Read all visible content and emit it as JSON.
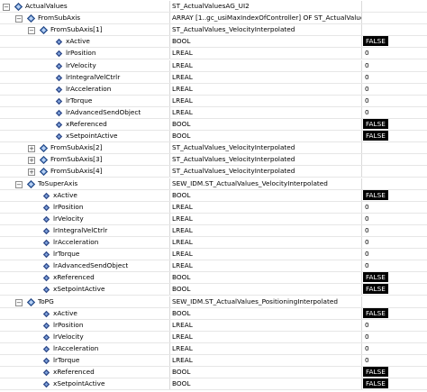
{
  "colors": {
    "false_badge_bg": "#000000",
    "false_badge_fg": "#ffffff",
    "icon_blue": "#2f4a8a"
  },
  "rows": [
    {
      "level": 0,
      "exp": "minus",
      "icon": "struct-icon",
      "name": "ActualValues",
      "type": "ST_ActualValuesAG_UI2",
      "value": ""
    },
    {
      "level": 1,
      "exp": "minus",
      "icon": "struct-icon",
      "name": "FromSubAxis",
      "type": "ARRAY [1..gc_usiMaxIndexOfController] OF ST_ActualValues",
      "value": ""
    },
    {
      "level": 2,
      "exp": "minus",
      "icon": "struct-icon",
      "name": "FromSubAxis[1]",
      "type": "ST_ActualValues_VelocityInterpolated",
      "value": ""
    },
    {
      "level": 3,
      "exp": "",
      "icon": "variable-icon",
      "name": "xActive",
      "type": "BOOL",
      "value": "FALSE",
      "badge": true
    },
    {
      "level": 3,
      "exp": "",
      "icon": "variable-icon",
      "name": "lrPosition",
      "type": "LREAL",
      "value": "0"
    },
    {
      "level": 3,
      "exp": "",
      "icon": "variable-icon",
      "name": "lrVelocity",
      "type": "LREAL",
      "value": "0"
    },
    {
      "level": 3,
      "exp": "",
      "icon": "variable-icon",
      "name": "lrIntegralVelCtrlr",
      "type": "LREAL",
      "value": "0"
    },
    {
      "level": 3,
      "exp": "",
      "icon": "variable-icon",
      "name": "lrAcceleration",
      "type": "LREAL",
      "value": "0"
    },
    {
      "level": 3,
      "exp": "",
      "icon": "variable-icon",
      "name": "lrTorque",
      "type": "LREAL",
      "value": "0"
    },
    {
      "level": 3,
      "exp": "",
      "icon": "variable-icon",
      "name": "lrAdvancedSendObject",
      "type": "LREAL",
      "value": "0"
    },
    {
      "level": 3,
      "exp": "",
      "icon": "variable-icon",
      "name": "xReferenced",
      "type": "BOOL",
      "value": "FALSE",
      "badge": true
    },
    {
      "level": 3,
      "exp": "",
      "icon": "variable-icon",
      "name": "xSetpointActive",
      "type": "BOOL",
      "value": "FALSE",
      "badge": true
    },
    {
      "level": 2,
      "exp": "plus",
      "icon": "struct-icon",
      "name": "FromSubAxis[2]",
      "type": "ST_ActualValues_VelocityInterpolated",
      "value": ""
    },
    {
      "level": 2,
      "exp": "plus",
      "icon": "struct-icon",
      "name": "FromSubAxis[3]",
      "type": "ST_ActualValues_VelocityInterpolated",
      "value": ""
    },
    {
      "level": 2,
      "exp": "plus",
      "icon": "struct-icon",
      "name": "FromSubAxis[4]",
      "type": "ST_ActualValues_VelocityInterpolated",
      "value": ""
    },
    {
      "level": 1,
      "exp": "minus",
      "icon": "struct-icon",
      "name": "ToSuperAxis",
      "type": "SEW_IDM.ST_ActualValues_VelocityInterpolated",
      "value": ""
    },
    {
      "level": 2,
      "exp": "",
      "icon": "variable-icon",
      "name": "xActive",
      "type": "BOOL",
      "value": "FALSE",
      "badge": true
    },
    {
      "level": 2,
      "exp": "",
      "icon": "variable-icon",
      "name": "lrPosition",
      "type": "LREAL",
      "value": "0"
    },
    {
      "level": 2,
      "exp": "",
      "icon": "variable-icon",
      "name": "lrVelocity",
      "type": "LREAL",
      "value": "0"
    },
    {
      "level": 2,
      "exp": "",
      "icon": "variable-icon",
      "name": "lrIntegralVelCtrlr",
      "type": "LREAL",
      "value": "0"
    },
    {
      "level": 2,
      "exp": "",
      "icon": "variable-icon",
      "name": "lrAcceleration",
      "type": "LREAL",
      "value": "0"
    },
    {
      "level": 2,
      "exp": "",
      "icon": "variable-icon",
      "name": "lrTorque",
      "type": "LREAL",
      "value": "0"
    },
    {
      "level": 2,
      "exp": "",
      "icon": "variable-icon",
      "name": "lrAdvancedSendObject",
      "type": "LREAL",
      "value": "0"
    },
    {
      "level": 2,
      "exp": "",
      "icon": "variable-icon",
      "name": "xReferenced",
      "type": "BOOL",
      "value": "FALSE",
      "badge": true
    },
    {
      "level": 2,
      "exp": "",
      "icon": "variable-icon",
      "name": "xSetpointActive",
      "type": "BOOL",
      "value": "FALSE",
      "badge": true
    },
    {
      "level": 1,
      "exp": "minus",
      "icon": "struct-icon",
      "name": "ToPG",
      "type": "SEW_IDM.ST_ActualValues_PositioningInterpolated",
      "value": ""
    },
    {
      "level": 2,
      "exp": "",
      "icon": "variable-icon",
      "name": "xActive",
      "type": "BOOL",
      "value": "FALSE",
      "badge": true
    },
    {
      "level": 2,
      "exp": "",
      "icon": "variable-icon",
      "name": "lrPosition",
      "type": "LREAL",
      "value": "0"
    },
    {
      "level": 2,
      "exp": "",
      "icon": "variable-icon",
      "name": "lrVelocity",
      "type": "LREAL",
      "value": "0"
    },
    {
      "level": 2,
      "exp": "",
      "icon": "variable-icon",
      "name": "lrAcceleration",
      "type": "LREAL",
      "value": "0"
    },
    {
      "level": 2,
      "exp": "",
      "icon": "variable-icon",
      "name": "lrTorque",
      "type": "LREAL",
      "value": "0"
    },
    {
      "level": 2,
      "exp": "",
      "icon": "variable-icon",
      "name": "xReferenced",
      "type": "BOOL",
      "value": "FALSE",
      "badge": true
    },
    {
      "level": 2,
      "exp": "",
      "icon": "variable-icon",
      "name": "xSetpointActive",
      "type": "BOOL",
      "value": "FALSE",
      "badge": true
    }
  ]
}
